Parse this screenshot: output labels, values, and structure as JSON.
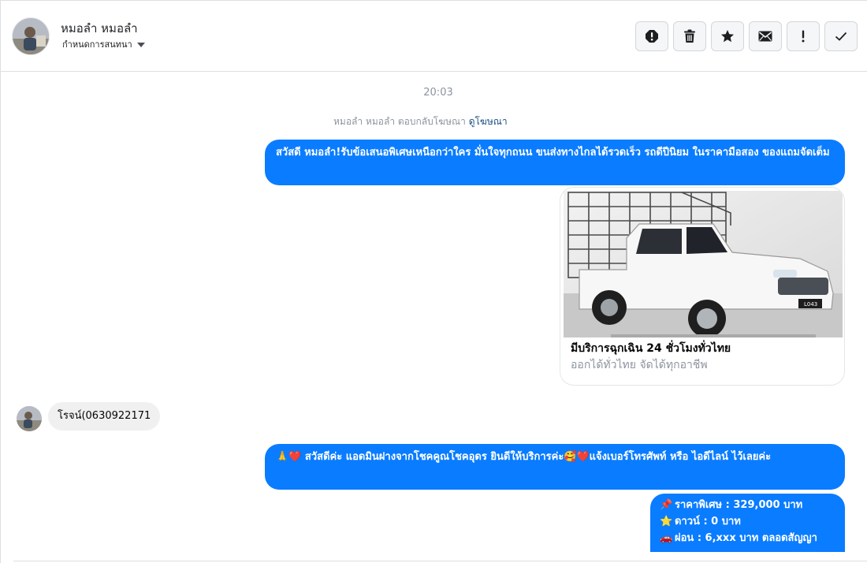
{
  "header": {
    "contact_name": "หมอลำ หมอลำ",
    "assign_label": "กำหนดการสนทนา",
    "actions": [
      {
        "name": "report-spam-button",
        "icon": "alert-circle-icon"
      },
      {
        "name": "delete-button",
        "icon": "trash-icon"
      },
      {
        "name": "star-button",
        "icon": "star-icon"
      },
      {
        "name": "mark-unread-button",
        "icon": "envelope-icon"
      },
      {
        "name": "mark-important-button",
        "icon": "exclamation-icon"
      },
      {
        "name": "mark-done-button",
        "icon": "check-icon"
      }
    ]
  },
  "thread": {
    "timestamp": "20:03",
    "reply_note": {
      "text": "หมอลำ หมอลำ ตอบกลับโฆษณา",
      "link": "ดูโฆษณา"
    },
    "messages": {
      "outgoing_1": "สวัสดี หมอลำ!รับข้อเสนอพิเศษเหนือกว่าใคร มั่นใจทุกถนน ขนส่งทางไกลได้รวดเร็ว รถดีปีนิยม ในราคามือสอง ของแถมจัดเต็ม",
      "ad_card": {
        "title": "มีบริการฉุกเฉิน 24 ชั่วโมงทั่วไทย",
        "subtitle": "ออกได้ทั่วไทย จัดได้ทุกอาชีพ",
        "plate": "L043"
      },
      "incoming_1": "โรจน์(0630922171",
      "outgoing_2": "🙏❤️ สวัสดีค่ะ แอดมินฝางจากโชคคูณโชคอุดร ยินดีให้บริการค่ะ🥰❤️แจ้งเบอร์โทรศัพท์ หรือ ไอดีไลน์  ไว้เลยค่ะ",
      "outgoing_3": {
        "line1": "ราคาพิเศษ : 329,000 บาท",
        "line2": "ดาวน์ : 0 บาท",
        "line3": "ผ่อน : 6,xxx บาท ตลอดสัญญา"
      }
    }
  },
  "colors": {
    "outgoing_bubble": "#0a7cff",
    "incoming_bubble": "#f0f0f0",
    "meta_text": "#8d949e",
    "link": "#1c4e80"
  }
}
